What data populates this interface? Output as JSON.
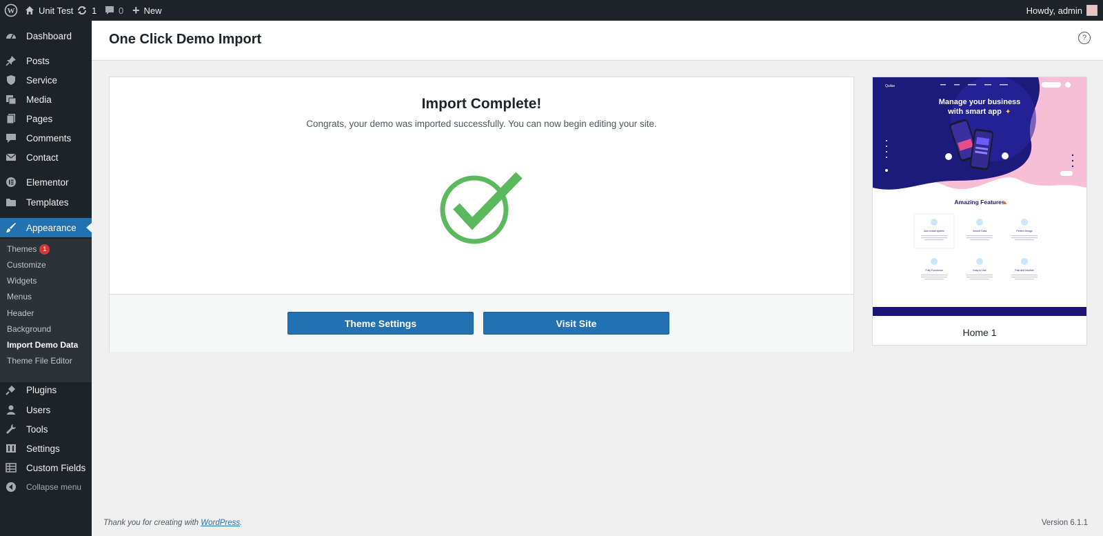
{
  "admin_bar": {
    "site_name": "Unit Test",
    "updates_count": "1",
    "comments_count": "0",
    "new_label": "New",
    "howdy": "Howdy, admin"
  },
  "sidebar": {
    "items": [
      {
        "label": "Dashboard",
        "icon": "dashboard-icon"
      },
      {
        "label": "Posts",
        "icon": "pin-icon"
      },
      {
        "label": "Service",
        "icon": "shield-icon"
      },
      {
        "label": "Media",
        "icon": "media-icon"
      },
      {
        "label": "Pages",
        "icon": "pages-icon"
      },
      {
        "label": "Comments",
        "icon": "comment-icon"
      },
      {
        "label": "Contact",
        "icon": "mail-icon"
      },
      {
        "label": "Elementor",
        "icon": "elementor-icon"
      },
      {
        "label": "Templates",
        "icon": "folder-icon"
      },
      {
        "label": "Appearance",
        "icon": "brush-icon"
      },
      {
        "label": "Plugins",
        "icon": "plug-icon"
      },
      {
        "label": "Users",
        "icon": "user-icon"
      },
      {
        "label": "Tools",
        "icon": "wrench-icon"
      },
      {
        "label": "Settings",
        "icon": "settings-icon"
      },
      {
        "label": "Custom Fields",
        "icon": "table-icon"
      }
    ],
    "submenu": [
      {
        "label": "Themes",
        "badge": "1"
      },
      {
        "label": "Customize"
      },
      {
        "label": "Widgets"
      },
      {
        "label": "Menus"
      },
      {
        "label": "Header"
      },
      {
        "label": "Background"
      },
      {
        "label": "Import Demo Data"
      },
      {
        "label": "Theme File Editor"
      }
    ],
    "collapse_label": "Collapse menu"
  },
  "page": {
    "title": "One Click Demo Import"
  },
  "import": {
    "heading": "Import Complete!",
    "message": "Congrats, your demo was imported successfully. You can now begin editing your site.",
    "theme_settings_label": "Theme Settings",
    "visit_site_label": "Visit Site"
  },
  "demo": {
    "name": "Home 1",
    "preview": {
      "logo": "Quilax",
      "headline_1": "Manage your business",
      "headline_2": "with smart app",
      "features_title": "Amazing Features",
      "features": [
        "Auto install system",
        "Secure Data",
        "Perfect Design",
        "Fully Functional",
        "Easy to Use",
        "Fast and Intuitive"
      ]
    }
  },
  "footer": {
    "thanks_prefix": "Thank you for creating with ",
    "wordpress_link": "WordPress",
    "thanks_suffix": ".",
    "version": "Version 6.1.1"
  },
  "colors": {
    "accent": "#2271b1",
    "success": "#5cb85c",
    "sidebar_bg": "#1d2327",
    "submenu_bg": "#2c3338"
  }
}
